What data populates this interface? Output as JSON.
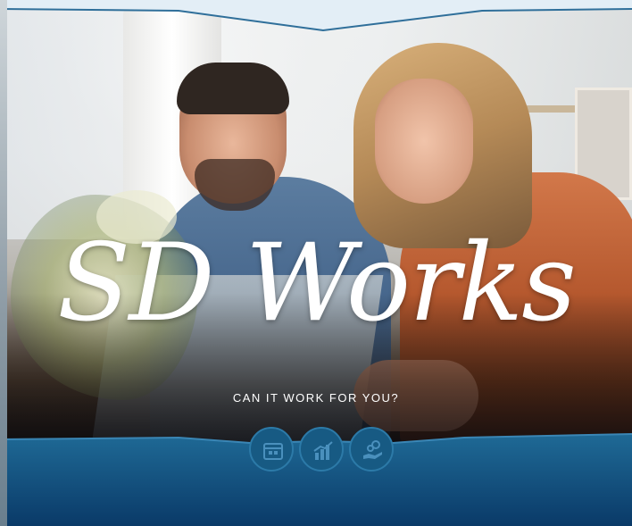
{
  "hero": {
    "wordmark": "SD Works",
    "tagline": "CAN IT WORK FOR YOU?"
  },
  "icons": [
    {
      "name": "calendar-icon"
    },
    {
      "name": "bar-chart-icon"
    },
    {
      "name": "hand-coins-icon"
    }
  ],
  "colors": {
    "banner_light_blue": "#e3eef6",
    "panel_blue_top": "#1f6a96",
    "panel_blue_bottom": "#0a3a68",
    "icon_circle": "#175a83"
  }
}
